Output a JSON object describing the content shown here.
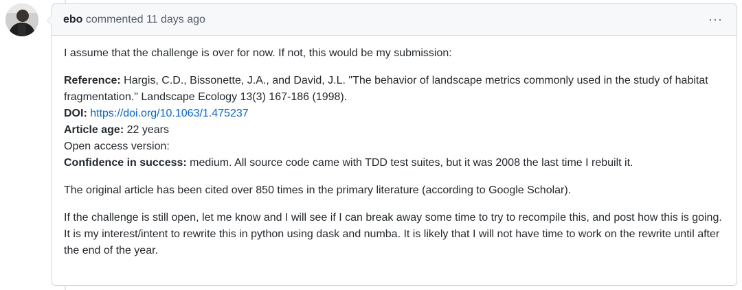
{
  "comment": {
    "author": "ebo",
    "meta": "commented 11 days ago",
    "more_label": "···",
    "paragraphs": {
      "intro": "I assume that the challenge is over for now. If not, this would be my submission:",
      "reference_label": "Reference:",
      "reference_text": " Hargis, C.D., Bissonette, J.A., and David, J.L. \"The behavior of landscape metrics commonly used in the study of habitat fragmentation.\" Landscape Ecology 13(3) 167-186 (1998).",
      "doi_label": "DOI:",
      "doi_link": "https://doi.org/10.1063/1.475237",
      "age_label": "Article age:",
      "age_text": " 22 years",
      "open_access": "Open access version:",
      "confidence_label": "Confidence in success:",
      "confidence_text": " medium. All source code came with TDD test suites, but it was 2008 the last time I rebuilt it.",
      "citations": "The original article has been cited over 850 times in the primary literature (according to Google Scholar).",
      "closing": "If the challenge is still open, let me know and I will see if I can break away some time to try to recompile this, and post how this is going. It is my interest/intent to rewrite this in python using dask and numba. It is likely that I will not have time to work on the rewrite until after the end of the year."
    }
  }
}
